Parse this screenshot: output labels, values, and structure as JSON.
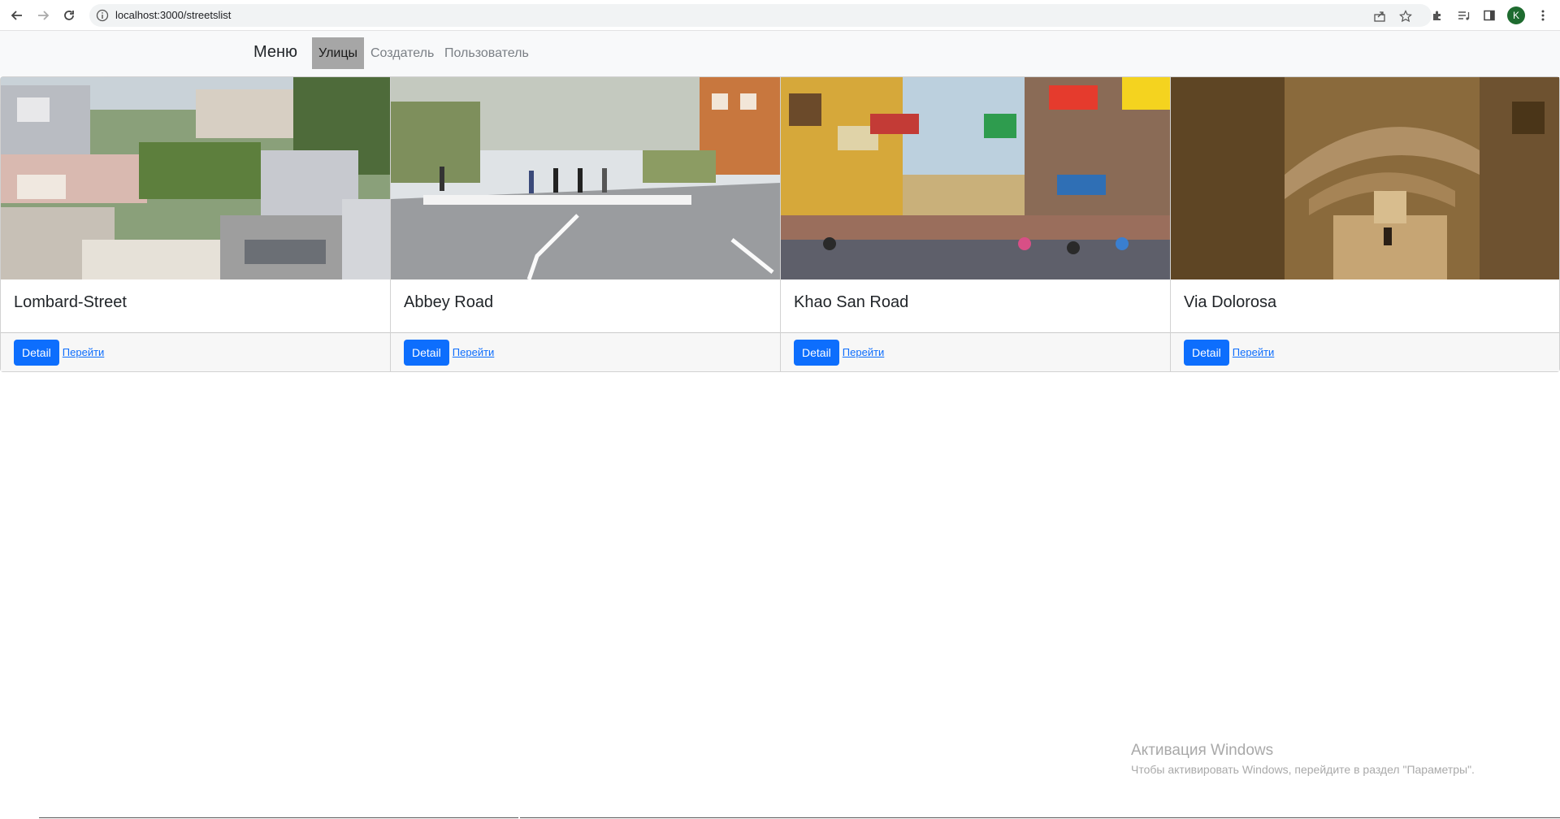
{
  "browser": {
    "url": "localhost:3000/streetslist",
    "avatar_letter": "K"
  },
  "navbar": {
    "brand": "Меню",
    "links": [
      {
        "label": "Улицы",
        "active": true
      },
      {
        "label": "Создатель",
        "active": false
      },
      {
        "label": "Пользователь",
        "active": false
      }
    ]
  },
  "cards": [
    {
      "title": "Lombard-Street",
      "detail_label": "Detail",
      "link_label": "Перейти"
    },
    {
      "title": "Abbey Road",
      "detail_label": "Detail",
      "link_label": "Перейти"
    },
    {
      "title": "Khao San Road",
      "detail_label": "Detail",
      "link_label": "Перейти"
    },
    {
      "title": "Via Dolorosa",
      "detail_label": "Detail",
      "link_label": "Перейти"
    }
  ],
  "watermark": {
    "title": "Активация Windows",
    "text": "Чтобы активировать Windows, перейдите в раздел \"Параметры\"."
  },
  "colors": {
    "primary": "#0d6efd",
    "navbar_bg": "#f8f9fa",
    "active_nav_bg": "#a6a6a6"
  }
}
